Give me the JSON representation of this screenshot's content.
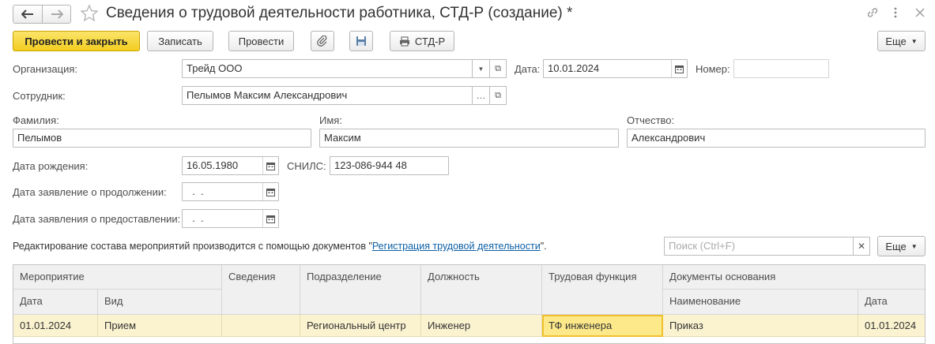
{
  "window": {
    "title": "Сведения о трудовой деятельности работника, СТД-Р (создание) *"
  },
  "toolbar": {
    "post_close": "Провести и закрыть",
    "save": "Записать",
    "post": "Провести",
    "print_std": "СТД-Р",
    "more": "Еще"
  },
  "form": {
    "org_label": "Организация:",
    "org_value": "Трейд ООО",
    "date_label": "Дата:",
    "date_value": "10.01.2024",
    "number_label": "Номер:",
    "number_value": "",
    "employee_label": "Сотрудник:",
    "employee_value": "Пелымов Максим Александрович",
    "lastname_label": "Фамилия:",
    "lastname_value": "Пелымов",
    "firstname_label": "Имя:",
    "firstname_value": "Максим",
    "patronymic_label": "Отчество:",
    "patronymic_value": "Александрович",
    "birth_label": "Дата рождения:",
    "birth_value": "16.05.1980",
    "snils_label": "СНИЛС:",
    "snils_value": "123-086-944 48",
    "continue_label": "Дата заявление о продолжении:",
    "continue_value": "  .  .",
    "provide_label": "Дата заявления о предоставлении:",
    "provide_value": "  .  ."
  },
  "info": {
    "text_before": "Редактирование состава мероприятий производится с помощью документов \"",
    "link": "Регистрация трудовой деятельности",
    "text_after": "\"."
  },
  "search": {
    "placeholder": "Поиск (Ctrl+F)",
    "more": "Еще"
  },
  "table": {
    "headers": {
      "event": "Мероприятие",
      "date": "Дата",
      "kind": "Вид",
      "info": "Сведения",
      "dept": "Подразделение",
      "position": "Должность",
      "function": "Трудовая функция",
      "docs": "Документы основания",
      "doc_name": "Наименование",
      "doc_date": "Дата"
    },
    "rows": [
      {
        "date": "01.01.2024",
        "kind": "Прием",
        "info": "",
        "dept": "Региональный центр",
        "position": "Инженер",
        "function": "ТФ инженера",
        "doc_name": "Приказ",
        "doc_date": "01.01.2024"
      }
    ]
  },
  "colors": {
    "primary_button": "#f3cd1f",
    "row_highlight": "#fbf3d0",
    "link": "#0b5fa5"
  }
}
